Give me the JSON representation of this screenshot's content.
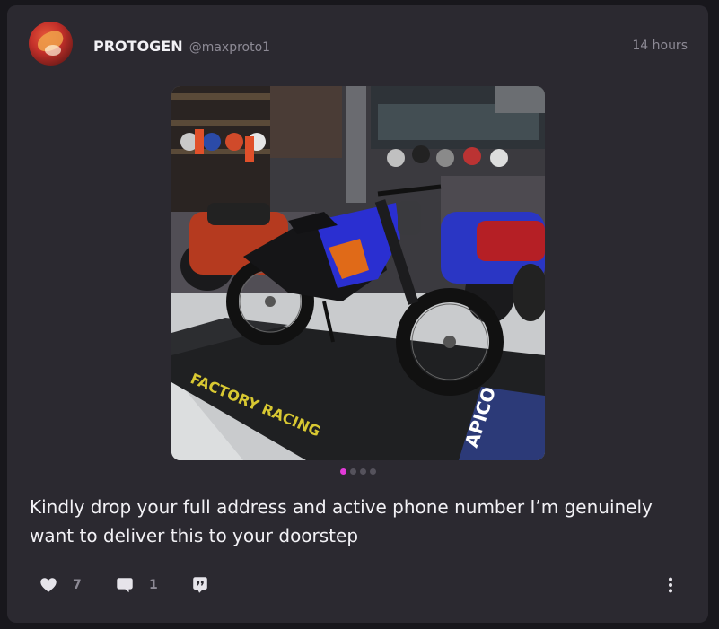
{
  "post": {
    "author": {
      "display_name": "PROTOGEN",
      "handle": "@maxproto1"
    },
    "timestamp": "14 hours",
    "media": {
      "mat_text": "FACTORY RACING",
      "brand_text": "APICO",
      "carousel_count": 4,
      "carousel_active": 0
    },
    "text_line1": "Kindly drop your full address and active phone number I’m genuinely",
    "text_line2": "want to deliver this to your doorstep",
    "actions": {
      "like_count": "7",
      "comment_count": "1"
    }
  },
  "colors": {
    "background": "#18171c",
    "card": "#2b2930",
    "text_primary": "#f2f1f5",
    "text_secondary": "#8d8a95",
    "accent_dot": "#e23ad8",
    "bike_blue": "#2a2fd1"
  },
  "icons": {
    "like": "heart-icon",
    "comment": "comment-bubble-icon",
    "share": "quote-share-icon",
    "more": "vertical-dots-icon"
  }
}
